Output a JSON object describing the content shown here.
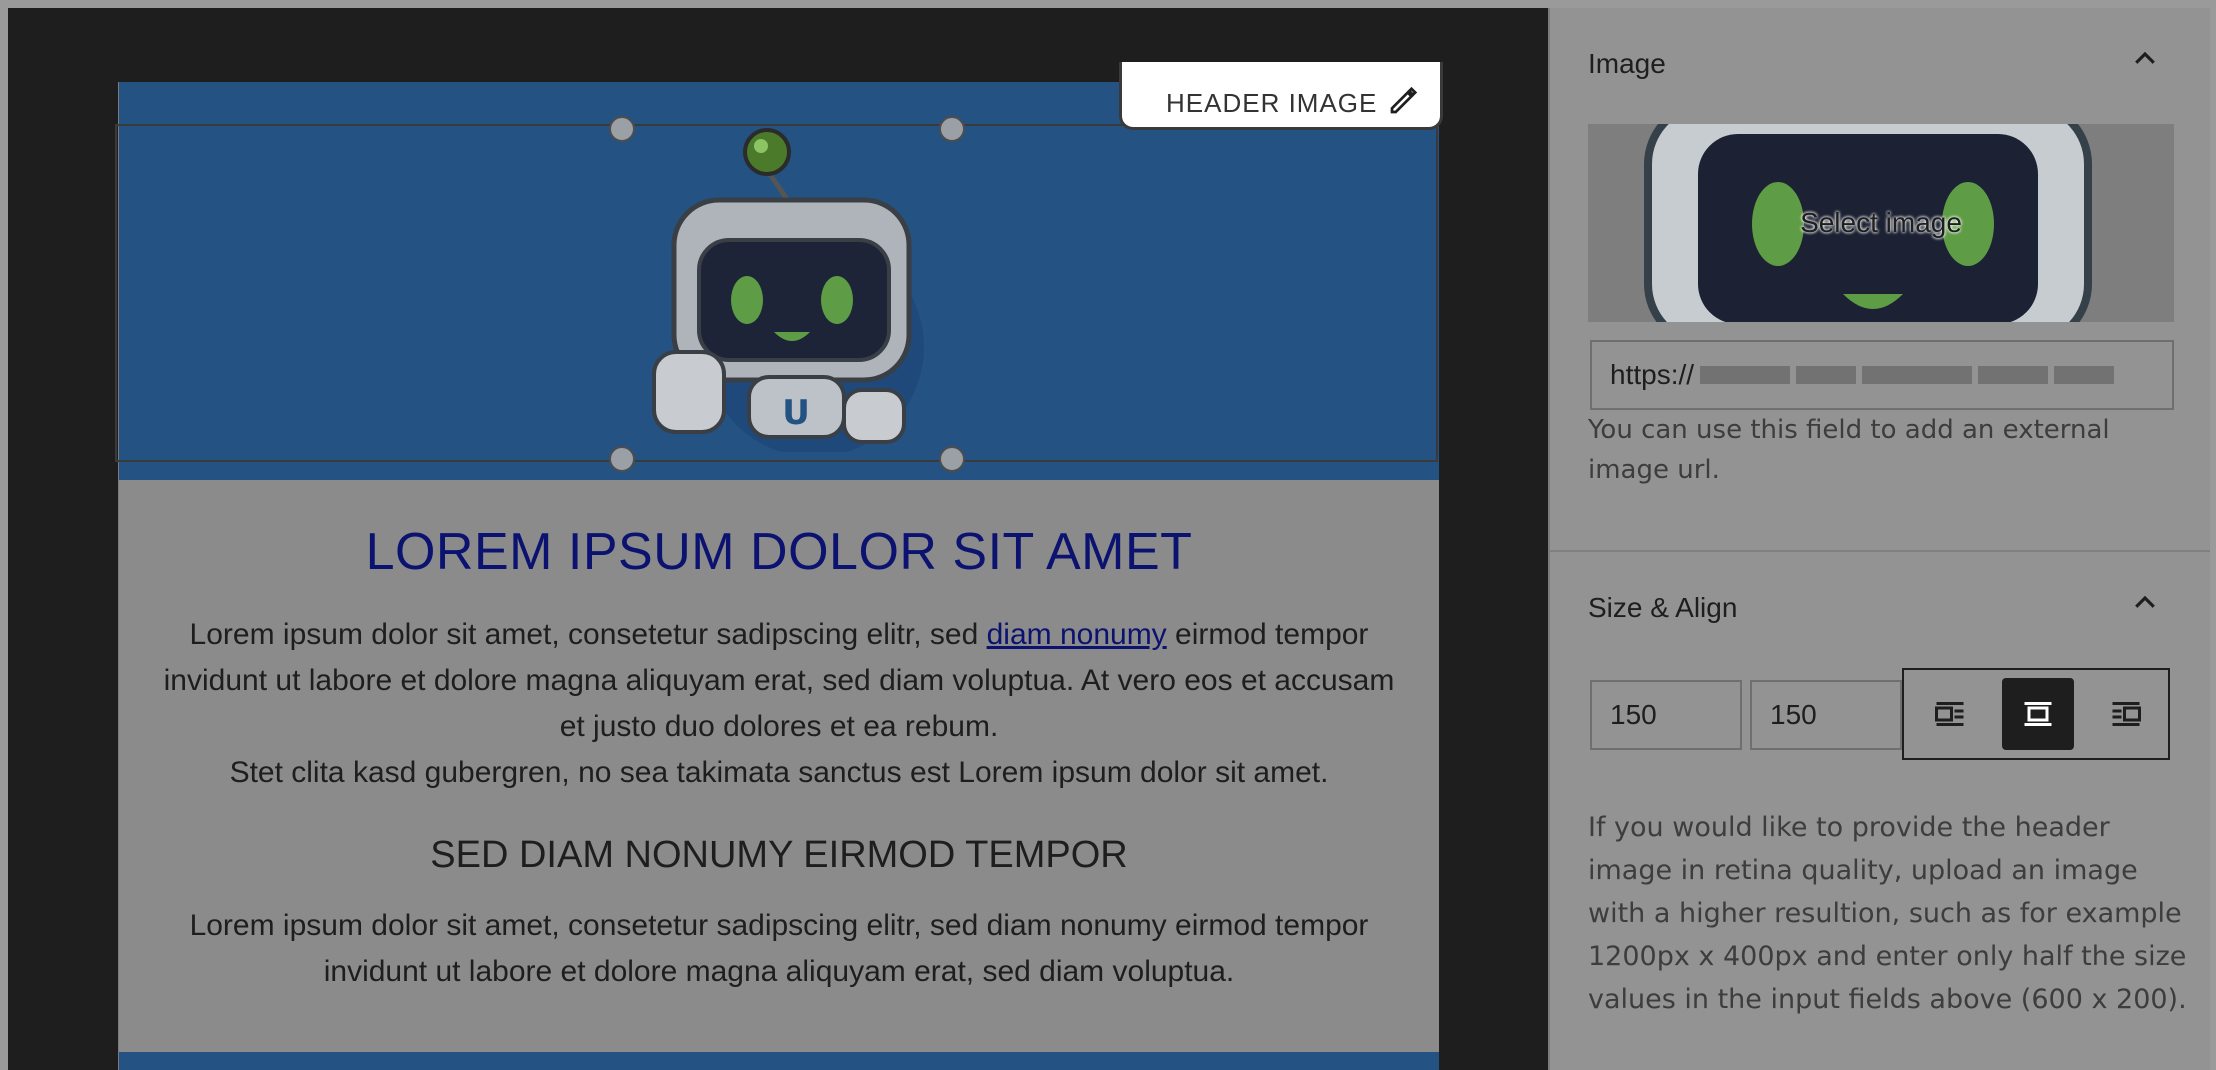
{
  "editor": {
    "block_label": "HEADER IMAGE",
    "edit_icon": "pencil-icon",
    "email": {
      "heading": "LOREM IPSUM DOLOR SIT AMET",
      "para1_before": "Lorem ipsum dolor sit amet, consetetur sadipscing elitr, sed ",
      "para1_link": "diam nonumy",
      "para1_after": " eirmod tempor invidunt ut labore et dolore magna aliquyam erat, sed diam voluptua. At vero eos et accusam et justo duo dolores et ea rebum.",
      "para1_line2": "Stet clita kasd gubergren, no sea takimata sanctus est Lorem ipsum dolor sit amet.",
      "subheading": "SED DIAM NONUMY EIRMOD TEMPOR",
      "para2": "Lorem ipsum dolor sit amet, consetetur sadipscing elitr, sed diam nonumy eirmod tempor invidunt ut labore et dolore magna aliquyam erat, sed diam voluptua."
    }
  },
  "sidebar": {
    "image_panel": {
      "title": "Image",
      "select_image": "Select image",
      "url_value": "https://",
      "url_help": "You can use this field to add an external image url."
    },
    "size_panel": {
      "title": "Size & Align",
      "width": "150",
      "height": "150",
      "align_options": [
        "align-left-icon",
        "align-center-icon",
        "align-right-icon"
      ],
      "active_align": "align-center-icon",
      "help": "If you would like to provide the header image in retina quality, upload an image with a higher resultion, such as for example 1200px x 400px and enter only half the size values in the input fields above (600 x 200)."
    }
  },
  "colors": {
    "header_blue": "#235283",
    "heading_navy": "#0b1270"
  }
}
